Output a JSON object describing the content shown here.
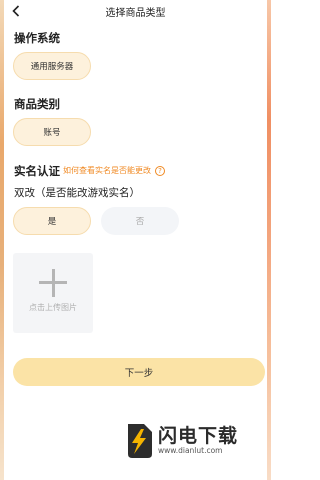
{
  "header": {
    "title": "选择商品类型"
  },
  "os_section": {
    "title": "操作系统",
    "option": "通用服务器"
  },
  "category_section": {
    "title": "商品类别",
    "option": "账号"
  },
  "realname_section": {
    "title": "实名认证",
    "hint_link": "如何查看实名是否能更改",
    "hint_icon": "?",
    "question": "双改（是否能改游戏实名）",
    "options": [
      "是",
      "否"
    ]
  },
  "upload": {
    "label": "点击上传图片"
  },
  "next_button": {
    "label": "下一步"
  },
  "watermark": {
    "name": "闪电下载",
    "url": "www.dianlut.com"
  },
  "colors": {
    "accent_yellow": "#fbe3a6",
    "selected_pill": "#fdf1dc",
    "hint_orange": "#f08a24"
  }
}
